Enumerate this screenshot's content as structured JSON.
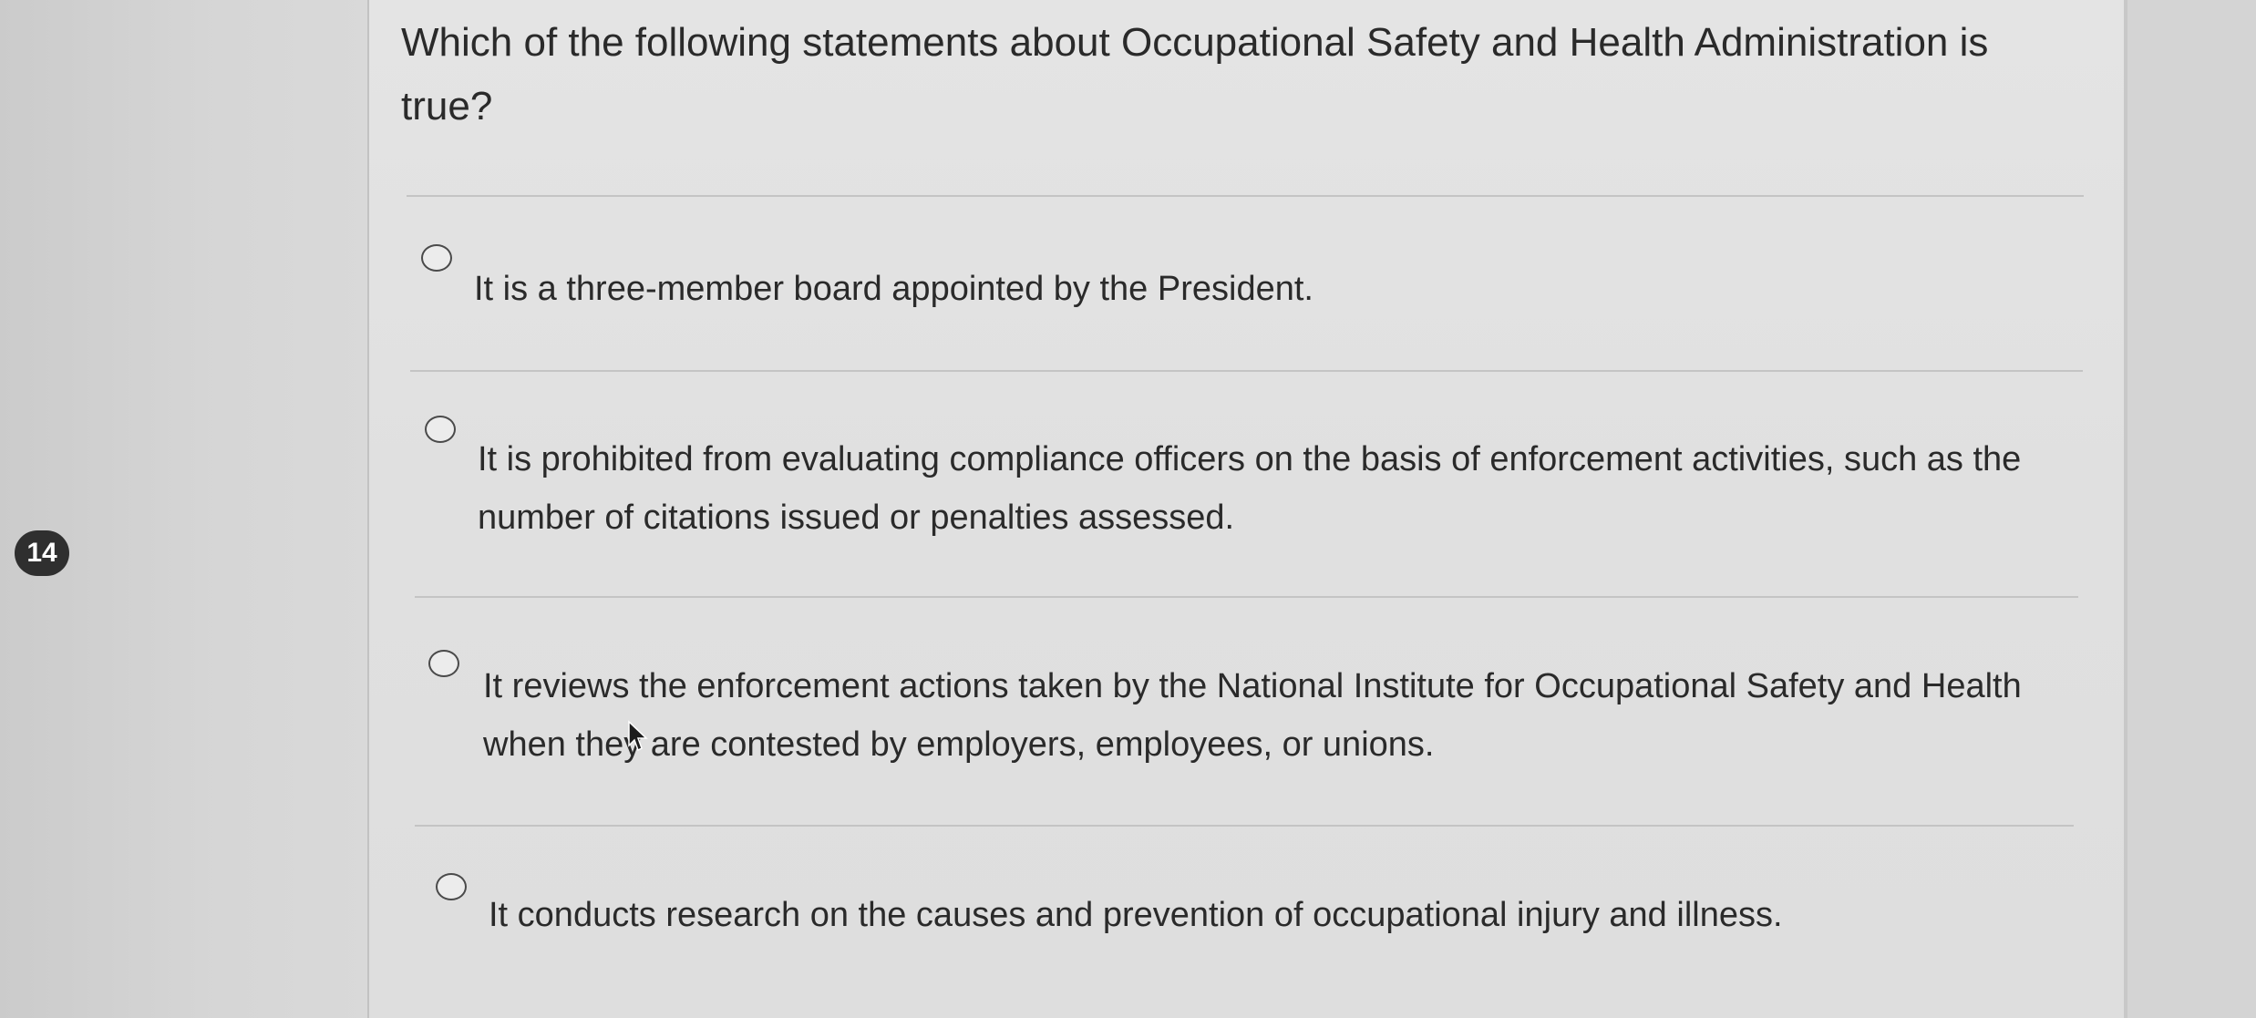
{
  "question": {
    "number": "14",
    "text": "Which of the following statements about Occupational Safety and Health Administration is true?"
  },
  "options": [
    {
      "label": "It is a three-member board appointed by the President.",
      "selected": false
    },
    {
      "label": "It is prohibited from evaluating compliance officers on the basis of enforcement activities, such as the number of citations issued or penalties assessed.",
      "selected": false
    },
    {
      "label": "It reviews the enforcement actions taken by the National Institute for Occupational Safety and Health when they are contested by employers, employees, or unions.",
      "selected": false
    },
    {
      "label": "It conducts research on the causes and prevention of occupational injury and illness.",
      "selected": false
    }
  ],
  "icons": {
    "radio": "radio-unchecked-icon",
    "cursor": "mouse-pointer-icon"
  },
  "colors": {
    "badge": "#2f2f2f",
    "text": "#2a2a2a",
    "background": "#e2e2e2"
  }
}
